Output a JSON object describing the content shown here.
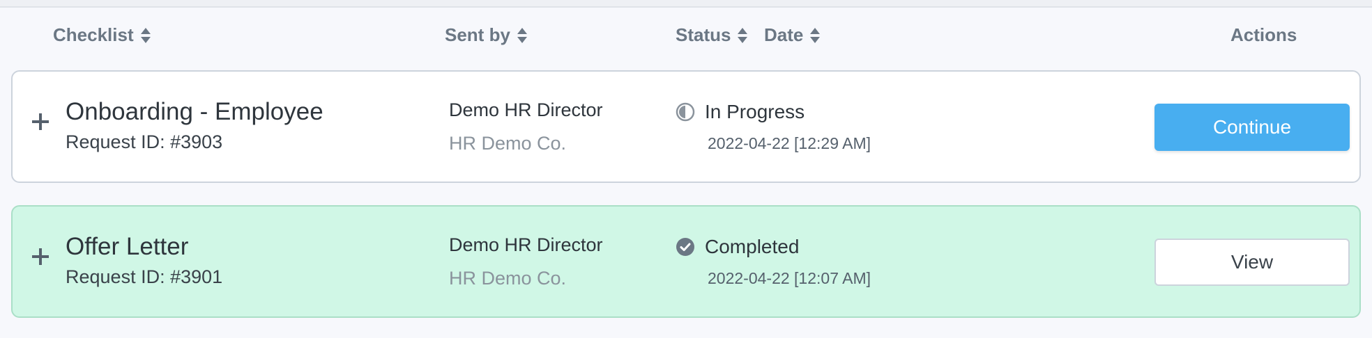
{
  "table": {
    "headers": {
      "checklist": "Checklist",
      "sent_by": "Sent by",
      "status": "Status",
      "date": "Date",
      "actions": "Actions"
    },
    "rows": [
      {
        "title": "Onboarding - Employee",
        "request_id": "Request ID: #3903",
        "sender_name": "Demo HR Director",
        "sender_company": "HR Demo Co.",
        "status": "In Progress",
        "status_icon": "half-circle-progress-icon",
        "date": "2022-04-22 [12:29 AM]",
        "action_label": "Continue"
      },
      {
        "title": "Offer Letter",
        "request_id": "Request ID: #3901",
        "sender_name": "Demo HR Director",
        "sender_company": "HR Demo Co.",
        "status": "Completed",
        "status_icon": "check-circle-icon",
        "date": "2022-04-22 [12:07 AM]",
        "action_label": "View"
      }
    ]
  },
  "colors": {
    "primary_button": "#48aef0",
    "completed_row_bg": "#d0f7e6",
    "header_text": "#6b7784"
  }
}
